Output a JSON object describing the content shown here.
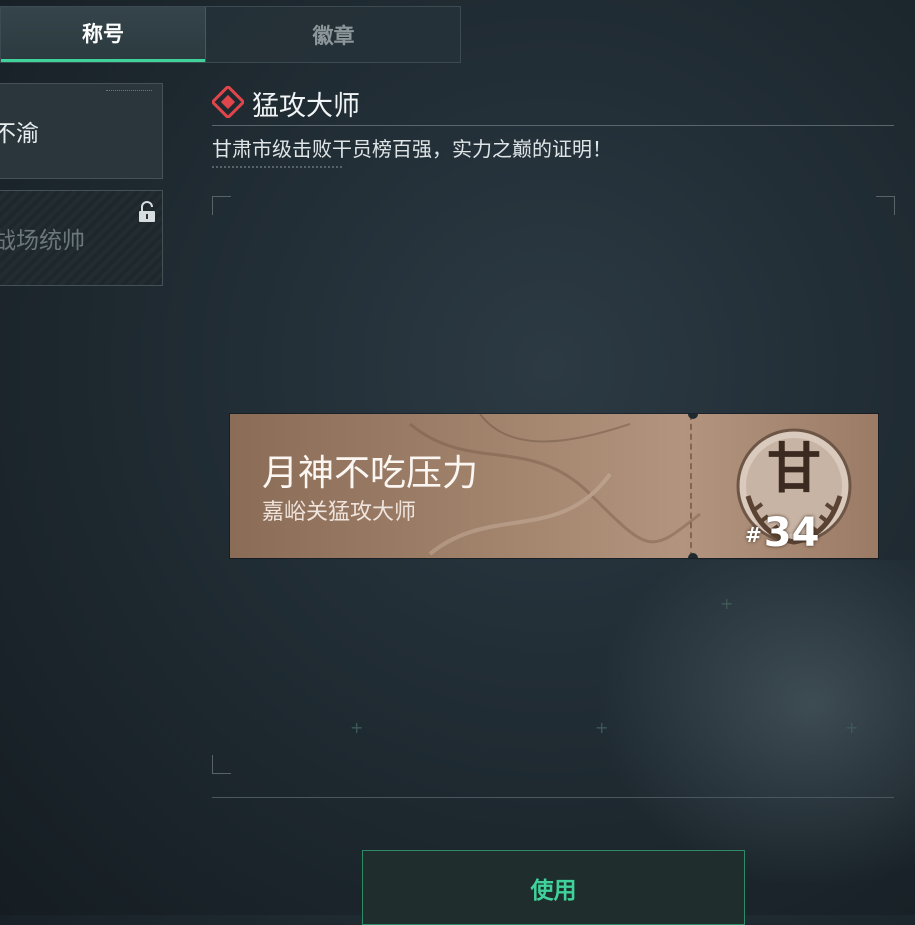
{
  "tabs": [
    {
      "label": "称号",
      "active": true
    },
    {
      "label": "徽章",
      "active": false
    }
  ],
  "title_list": [
    {
      "label": "不渝",
      "locked": false
    },
    {
      "label": "战场统帅",
      "locked": true
    }
  ],
  "detail": {
    "icon": "red-diamond-icon",
    "title": "猛攻大师",
    "description": "甘肃市级击败干员榜百强，实力之巅的证明！"
  },
  "nameplate": {
    "player_name": "月神不吃压力",
    "subtitle": "嘉峪关猛攻大师",
    "emblem_char": "甘",
    "rank_hash": "#",
    "rank": "34"
  },
  "actions": {
    "use_label": "使用"
  },
  "colors": {
    "accent": "#3fd39b",
    "icon_red": "#e0454b",
    "plate": "#a4866f"
  }
}
